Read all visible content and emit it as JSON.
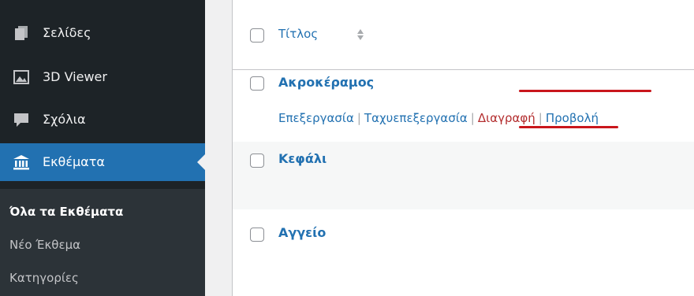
{
  "sidebar": {
    "items": [
      {
        "label": "Σελίδες",
        "icon": "pages-icon"
      },
      {
        "label": "3D Viewer",
        "icon": "image-icon"
      },
      {
        "label": "Σχόλια",
        "icon": "comment-icon"
      },
      {
        "label": "Εκθέματα",
        "icon": "museum-icon",
        "active": true
      }
    ],
    "submenu": [
      {
        "label": "Όλα τα Εκθέματα",
        "current": true
      },
      {
        "label": "Νέο Έκθεμα"
      },
      {
        "label": "Κατηγορίες"
      }
    ]
  },
  "table": {
    "column_title": "Τίτλος",
    "rows": [
      {
        "title": "Ακροκέραμος",
        "actions": {
          "edit": "Επεξεργασία",
          "quick_edit": "Ταχυεπεξεργασία",
          "delete": "Διαγραφή",
          "view": "Προβολή",
          "separator": "|"
        }
      },
      {
        "title": "Κεφάλι"
      },
      {
        "title": "Αγγείο"
      }
    ]
  },
  "colors": {
    "sidebar_bg": "#1d2327",
    "active_bg": "#2271b1",
    "link": "#2271b1",
    "delete": "#b32d2e",
    "annotation": "#c9161c"
  }
}
